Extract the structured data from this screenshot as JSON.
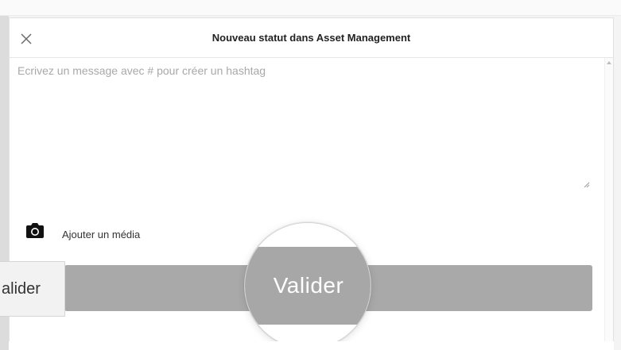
{
  "modal": {
    "title": "Nouveau statut dans Asset Management",
    "close_icon": "close-icon",
    "message_placeholder": "Ecrivez un message avec # pour créer un hashtag",
    "message_value": "",
    "add_media_label": "Ajouter un média",
    "add_media_icon": "camera-icon",
    "submit_label": "Valider"
  },
  "overlay": {
    "tag_label": "alider"
  },
  "colors": {
    "submit_bg": "#a9a9a9",
    "title_text": "#222222",
    "placeholder": "#a8a8a8"
  }
}
